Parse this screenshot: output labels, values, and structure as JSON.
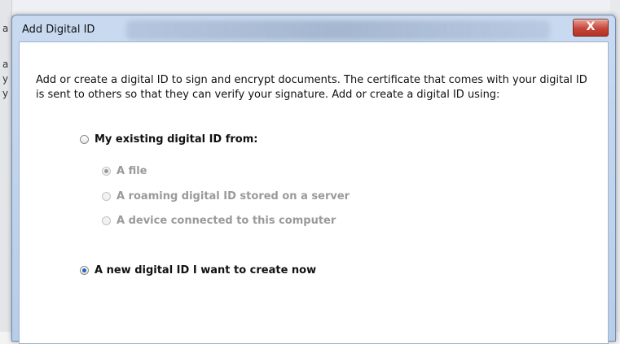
{
  "background": {
    "left_chars": [
      "a",
      "a",
      "y",
      "y"
    ]
  },
  "dialog": {
    "title": "Add Digital ID",
    "close_label": "X",
    "description": "Add or create a digital ID to sign and encrypt documents. The certificate that comes with your digital ID is sent to others so that they can verify your signature. Add or create a digital ID using:",
    "options": {
      "existing": {
        "label": "My existing digital ID from:",
        "selected": false
      },
      "file": {
        "label": "A file",
        "selected": true,
        "enabled": false
      },
      "roaming": {
        "label": "A roaming digital ID stored on a server",
        "selected": false,
        "enabled": false
      },
      "device": {
        "label": "A device connected to this computer",
        "selected": false,
        "enabled": false
      },
      "new": {
        "label": "A new digital ID I want to create now",
        "selected": true
      }
    }
  },
  "colors": {
    "radio_accent": "#1f63c0",
    "disabled_text": "#9a9a9a",
    "close_button": "#c7463a"
  }
}
